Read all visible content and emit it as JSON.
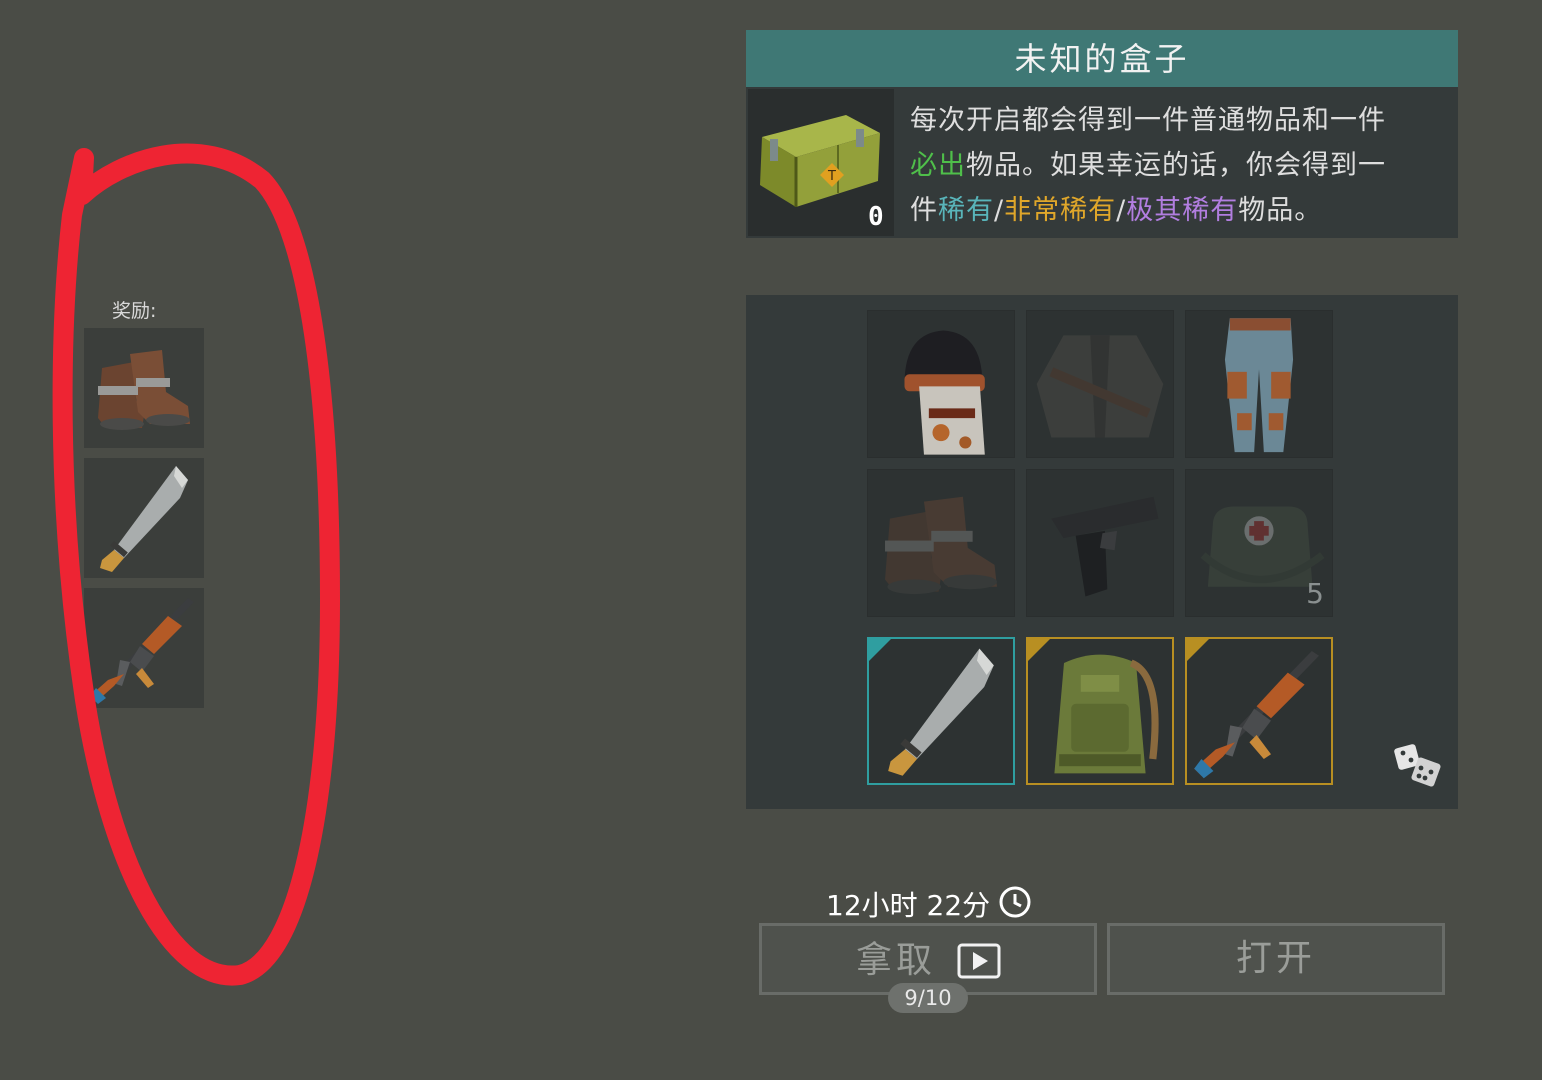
{
  "rewards": {
    "label": "奖励:",
    "items": [
      {
        "icon": "boots-icon"
      },
      {
        "icon": "machete-icon"
      },
      {
        "icon": "ak-rifle-icon"
      }
    ]
  },
  "box": {
    "title": "未知的盒子",
    "count": "0",
    "description": {
      "line1": "每次开启都会得到一件普通物品和一件",
      "guaranteed": "必出",
      "line2_rest": "物品。如果幸运的话，你会得到一",
      "prefix3": "件",
      "rare": "稀有",
      "very_rare": "非常稀有",
      "extremely_rare": "极其稀有",
      "suffix3": "物品。",
      "sep": "/"
    }
  },
  "loot": {
    "slots": [
      {
        "icon": "helmet-icon",
        "state": "normal"
      },
      {
        "icon": "jacket-icon",
        "state": "dim"
      },
      {
        "icon": "pants-icon",
        "state": "normal"
      },
      {
        "icon": "boots-icon",
        "state": "dim"
      },
      {
        "icon": "pistol-icon",
        "state": "normal"
      },
      {
        "icon": "medkit-bag-icon",
        "state": "dim",
        "count": "5"
      },
      {
        "icon": "machete-icon",
        "state": "rare-teal"
      },
      {
        "icon": "backpack-icon",
        "state": "rare-gold"
      },
      {
        "icon": "ak-rifle-icon",
        "state": "rare-gold"
      }
    ]
  },
  "controls": {
    "timer": "12小时 22分",
    "take_label": "拿取",
    "open_label": "打开",
    "counter": "9/10"
  },
  "colors": {
    "header": "#3f7875",
    "rare_teal": "#2f9ea0",
    "rare_gold": "#b88f22",
    "guaranteed_green": "#4fbf4a",
    "rare_purple": "#b27ee0",
    "annotation_red": "#ee2433"
  }
}
